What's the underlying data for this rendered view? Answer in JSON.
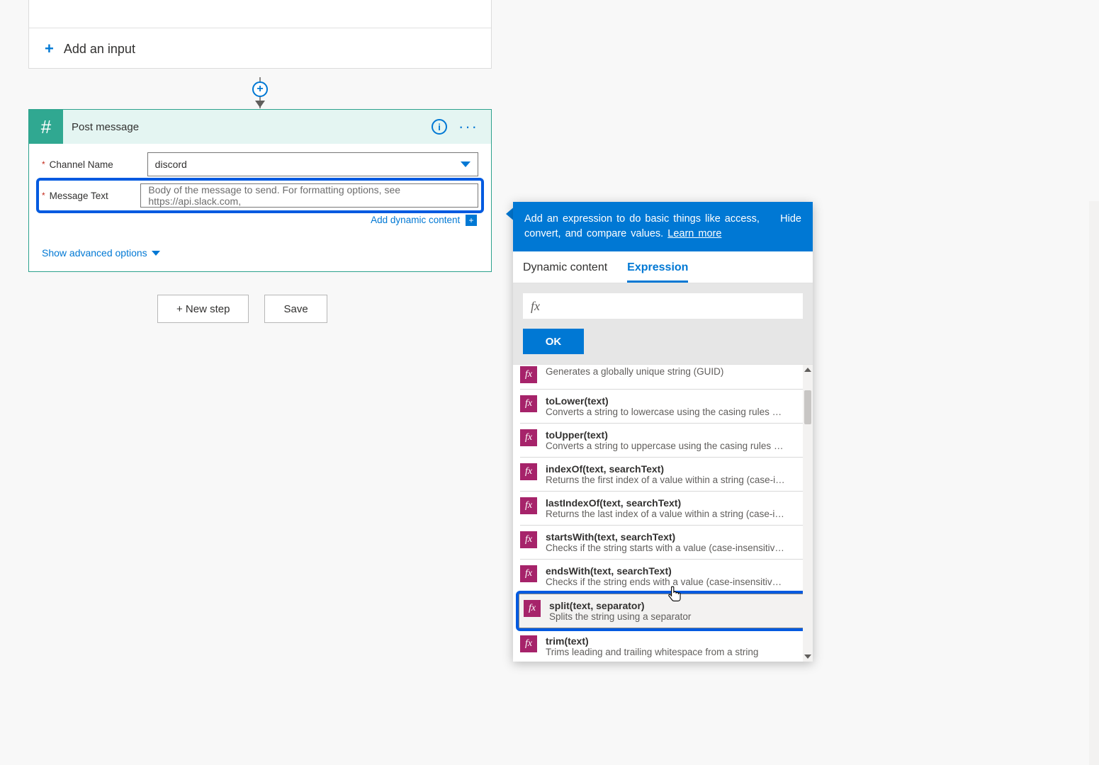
{
  "trigger": {
    "add_input_label": "Add an input"
  },
  "action": {
    "title": "Post message",
    "fields": {
      "channel": {
        "label": "Channel Name",
        "value": "discord"
      },
      "message": {
        "label": "Message Text",
        "placeholder": "Body of the message to send. For formatting options, see https://api.slack.com,"
      }
    },
    "add_dynamic_label": "Add dynamic content",
    "advanced_label": "Show advanced options"
  },
  "buttons": {
    "new_step": "+ New step",
    "save": "Save"
  },
  "flyout": {
    "header_text": "Add an expression to do basic things like access, convert, and compare values. ",
    "learn_more": "Learn more",
    "hide": "Hide",
    "tabs": {
      "dynamic": "Dynamic content",
      "expression": "Expression"
    },
    "fx_prefix": "fx",
    "ok": "OK",
    "funcs": [
      {
        "sig": "",
        "desc": "Generates a globally unique string (GUID)",
        "cutoff_top": true
      },
      {
        "sig": "toLower(text)",
        "desc": "Converts a string to lowercase using the casing rules of t..."
      },
      {
        "sig": "toUpper(text)",
        "desc": "Converts a string to uppercase using the casing rules of t..."
      },
      {
        "sig": "indexOf(text, searchText)",
        "desc": "Returns the first index of a value within a string (case-inse..."
      },
      {
        "sig": "lastIndexOf(text, searchText)",
        "desc": "Returns the last index of a value within a string (case-inse..."
      },
      {
        "sig": "startsWith(text, searchText)",
        "desc": "Checks if the string starts with a value (case-insensitive, in..."
      },
      {
        "sig": "endsWith(text, searchText)",
        "desc": "Checks if the string ends with a value (case-insensitive, in..."
      },
      {
        "sig": "split(text, separator)",
        "desc": "Splits the string using a separator",
        "highlight": true
      },
      {
        "sig": "trim(text)",
        "desc": "Trims leading and trailing whitespace from a string"
      }
    ]
  }
}
